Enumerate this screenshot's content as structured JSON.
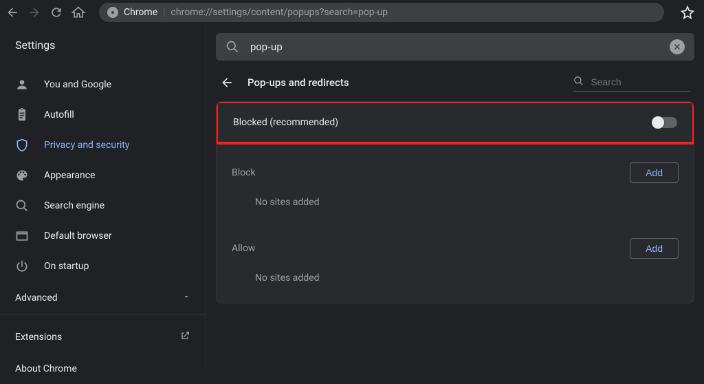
{
  "omnibox": {
    "origin_label": "Chrome",
    "url_suffix": "chrome://settings/content/popups?search=pop-up"
  },
  "app_title": "Settings",
  "sidebar": {
    "items": [
      {
        "label": "You and Google"
      },
      {
        "label": "Autofill"
      },
      {
        "label": "Privacy and security"
      },
      {
        "label": "Appearance"
      },
      {
        "label": "Search engine"
      },
      {
        "label": "Default browser"
      },
      {
        "label": "On startup"
      }
    ],
    "advanced_label": "Advanced",
    "extensions_label": "Extensions",
    "about_label": "About Chrome"
  },
  "topsearch": {
    "value": "pop-up"
  },
  "page": {
    "title": "Pop-ups and redirects",
    "search_placeholder": "Search"
  },
  "toggle_row": {
    "label": "Blocked (recommended)",
    "checked": false
  },
  "block_section": {
    "label": "Block",
    "add_label": "Add",
    "empty": "No sites added"
  },
  "allow_section": {
    "label": "Allow",
    "add_label": "Add",
    "empty": "No sites added"
  }
}
